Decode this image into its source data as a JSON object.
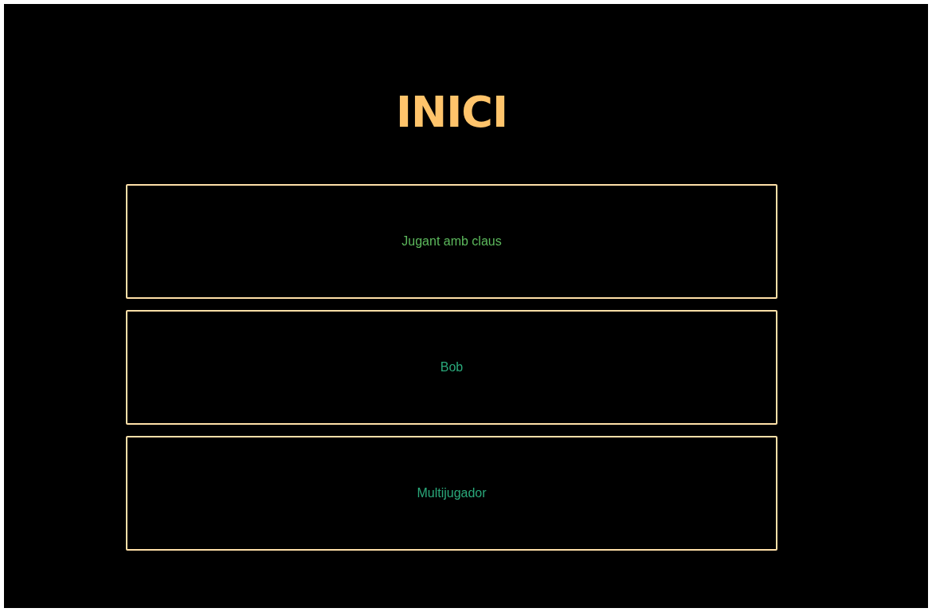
{
  "title": "INICI",
  "buttons": [
    {
      "label": "Jugant amb claus",
      "color": "#5cb85c"
    },
    {
      "label": "Bob",
      "color": "#2aa87a"
    },
    {
      "label": "Multijugador",
      "color": "#2aa87a"
    }
  ]
}
